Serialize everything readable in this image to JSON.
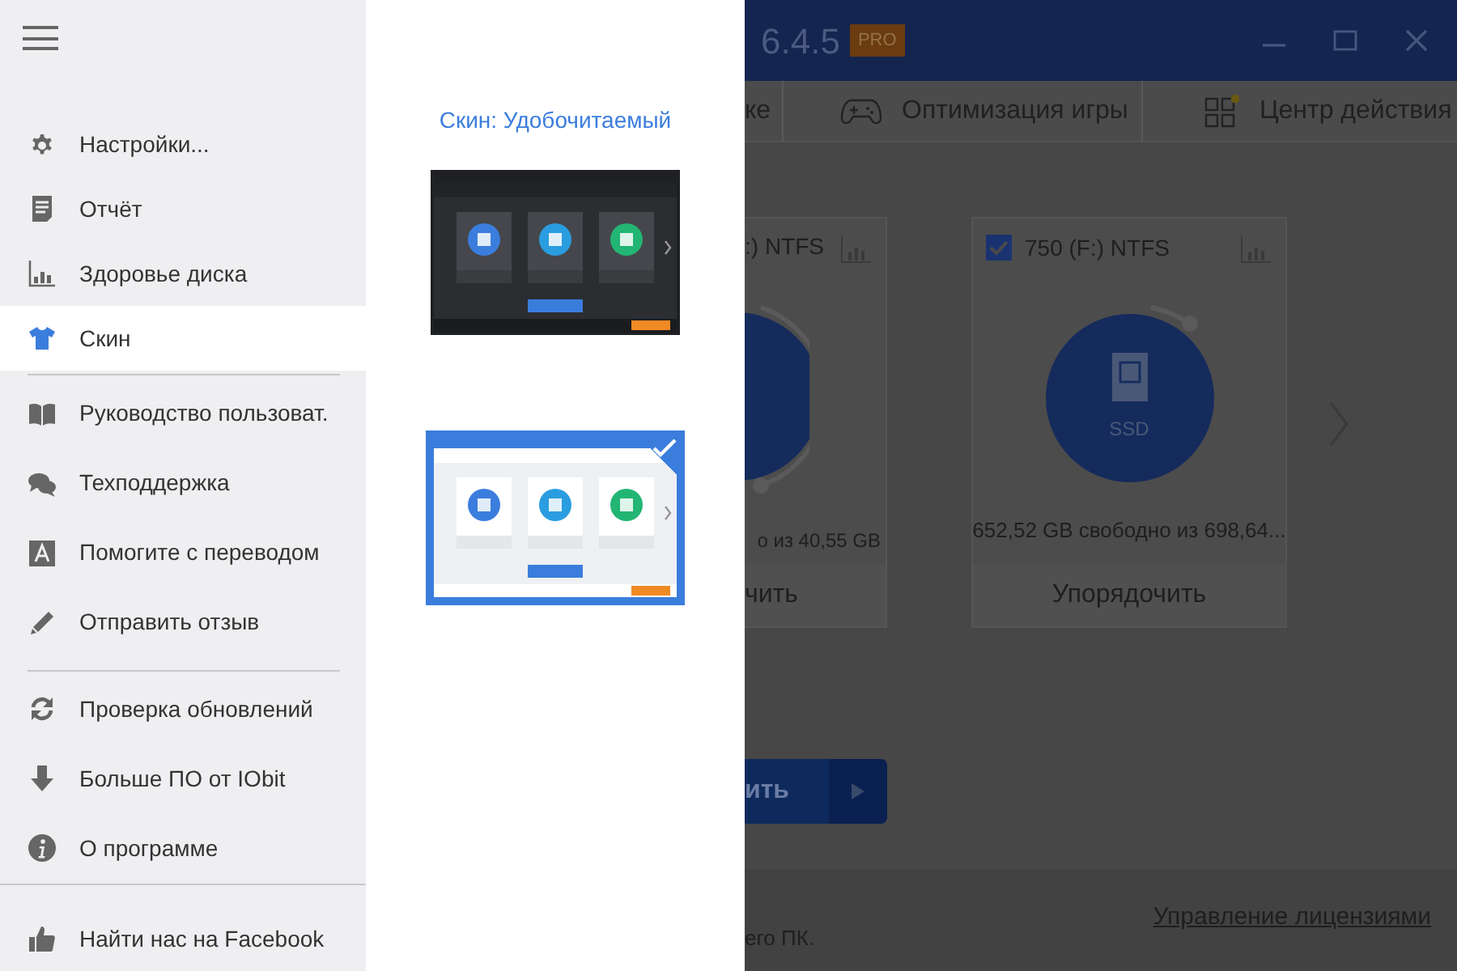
{
  "menu": {
    "sections": [
      {
        "items": [
          {
            "label": "Настройки...",
            "selected": false
          },
          {
            "label": "Отчёт",
            "selected": false
          },
          {
            "label": "Здоровье диска",
            "selected": false
          },
          {
            "label": "Скин",
            "selected": true
          }
        ]
      },
      {
        "items": [
          {
            "label": "Руководство пользоват.",
            "selected": false
          },
          {
            "label": "Техподдержка",
            "selected": false
          },
          {
            "label": "Помогите с переводом",
            "selected": false
          },
          {
            "label": "Отправить отзыв",
            "selected": false
          }
        ]
      },
      {
        "items": [
          {
            "label": "Проверка обновлений",
            "selected": false
          },
          {
            "label": "Больше ПО от IObit",
            "selected": false
          },
          {
            "label": "О программе",
            "selected": false
          }
        ]
      },
      {
        "items": [
          {
            "label": "Найти нас на Facebook",
            "selected": false
          }
        ]
      }
    ]
  },
  "skin_panel": {
    "title": "Скин: Удобочитаемый",
    "skins": [
      {
        "kind": "dark",
        "selected": false
      },
      {
        "kind": "light",
        "selected": true
      }
    ]
  },
  "app": {
    "title": "6.4.5",
    "badge": "PRO",
    "tabs": [
      {
        "label": "ке"
      },
      {
        "label": "Оптимизация игры"
      },
      {
        "label": "Центр действия"
      }
    ],
    "drives": [
      {
        "name": ":) NTFS",
        "usage": "о из 40,55 GB",
        "action": "чить"
      },
      {
        "name": "750 (F:) NTFS",
        "checked": true,
        "disk_label": "SSD",
        "usage": "652,52 GB свободно из 698,64...",
        "action": "Упорядочить"
      }
    ],
    "start_button": {
      "label": "ить"
    },
    "footer": {
      "note": "его ПК.",
      "link": "Управление лицензиями"
    }
  }
}
